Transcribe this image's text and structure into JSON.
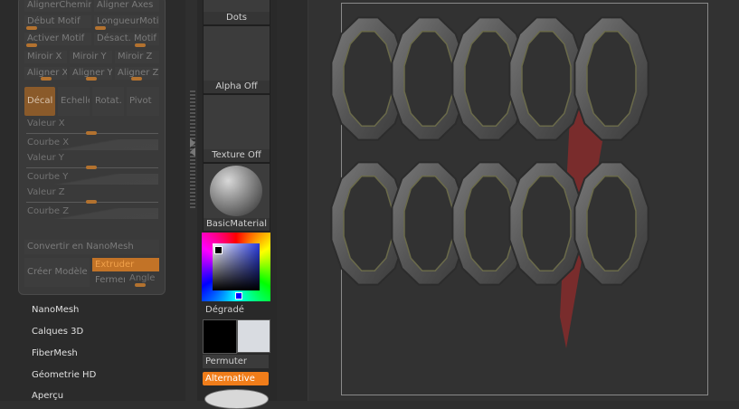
{
  "deformation": {
    "row1": [
      "AlignerChemin",
      "Aligner Axes"
    ],
    "row2": [
      "Début Motif",
      "LongueurMotif"
    ],
    "row3": [
      "Activer Motif",
      "Désact. Motif"
    ],
    "row4": [
      "Miroir X",
      "Miroir Y",
      "Miroir Z"
    ],
    "row5": [
      "Aligner X",
      "Aligner Y",
      "Aligner Z"
    ],
    "transform": [
      "Décal",
      "Echelle",
      "Rotat.",
      "Pivot"
    ],
    "value_x": "Valeur X",
    "curve_x": "Courbe X",
    "value_y": "Valeur Y",
    "curve_y": "Courbe Y",
    "value_z": "Valeur Z",
    "curve_z": "Courbe Z",
    "nanomesh_convert": "Convertir en NanoMesh",
    "create_model": "Créer Modèle",
    "extrude": "Extruder",
    "close": "Fermer",
    "angle": "Angle"
  },
  "subpalettes": [
    "NanoMesh",
    "Calques 3D",
    "FiberMesh",
    "Géometrie HD",
    "Aperçu"
  ],
  "tray": {
    "dots": "Dots",
    "alpha": "Alpha Off",
    "texture": "Texture Off",
    "material": "BasicMaterial",
    "gradient": "Dégradé",
    "swap": "Permuter",
    "alternate": "Alternative"
  },
  "colors": {
    "accent": "#f07d1a",
    "active_button": "#8a5a2a",
    "main_color": "#000000",
    "secondary_color": "#d9dce1",
    "mesh_gray": "#5b5b5b",
    "stroke_red": "#8b2a2a"
  }
}
